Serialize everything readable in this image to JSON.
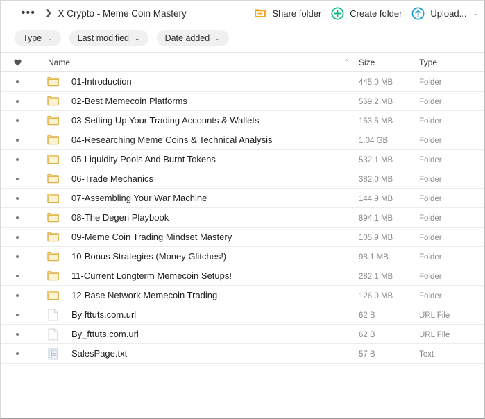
{
  "window": {
    "border_color": "#d8d8d8"
  },
  "breadcrumb": {
    "ellipsis": "•••",
    "separator": "❯",
    "title": "X Crypto - Meme Coin Mastery"
  },
  "toolbar": {
    "share_folder_label": "Share folder",
    "create_folder_label": "Create folder",
    "upload_label": "Upload...",
    "upload_caret": "⌄",
    "icons": {
      "share_folder": "share-folder-icon",
      "create_folder": "create-folder-icon",
      "upload": "upload-icon",
      "upload_caret": "chevron-down-icon"
    },
    "colors": {
      "share_folder": "#f5a623",
      "create_folder": "#00b87c",
      "upload": "#1e9ad6"
    }
  },
  "filters": [
    {
      "label": "Type",
      "caret": "⌄"
    },
    {
      "label": "Last modified",
      "caret": "⌄"
    },
    {
      "label": "Date added",
      "caret": "⌄"
    }
  ],
  "table": {
    "header": {
      "favorite_icon": "heart-icon",
      "name": "Name",
      "sort_caret": "⌃",
      "size": "Size",
      "type": "Type"
    },
    "rows": [
      {
        "icon": "folder-icon",
        "name": "01-Introduction",
        "size": "445.0 MB",
        "type": "Folder"
      },
      {
        "icon": "folder-icon",
        "name": "02-Best Memecoin Platforms",
        "size": "569.2 MB",
        "type": "Folder"
      },
      {
        "icon": "folder-icon",
        "name": "03-Setting Up Your Trading Accounts & Wallets",
        "size": "153.5 MB",
        "type": "Folder"
      },
      {
        "icon": "folder-icon",
        "name": "04-Researching Meme Coins & Technical Analysis",
        "size": "1.04 GB",
        "type": "Folder"
      },
      {
        "icon": "folder-icon",
        "name": "05-Liquidity Pools And Burnt Tokens",
        "size": "532.1 MB",
        "type": "Folder"
      },
      {
        "icon": "folder-icon",
        "name": "06-Trade Mechanics",
        "size": "382.0 MB",
        "type": "Folder"
      },
      {
        "icon": "folder-icon",
        "name": "07-Assembling Your War Machine",
        "size": "144.9 MB",
        "type": "Folder"
      },
      {
        "icon": "folder-icon",
        "name": "08-The Degen Playbook",
        "size": "894.1 MB",
        "type": "Folder"
      },
      {
        "icon": "folder-icon",
        "name": "09-Meme Coin Trading Mindset Mastery",
        "size": "105.9 MB",
        "type": "Folder"
      },
      {
        "icon": "folder-icon",
        "name": "10-Bonus Strategies (Money Glitches!)",
        "size": "98.1 MB",
        "type": "Folder"
      },
      {
        "icon": "folder-icon",
        "name": "11-Current Longterm Memecoin Setups!",
        "size": "282.1 MB",
        "type": "Folder"
      },
      {
        "icon": "folder-icon",
        "name": "12-Base Network Memecoin Trading",
        "size": "126.0 MB",
        "type": "Folder"
      },
      {
        "icon": "url-file-icon",
        "name": "By fttuts.com.url",
        "size": "62 B",
        "type": "URL File"
      },
      {
        "icon": "url-file-icon",
        "name": "By_fttuts.com.url",
        "size": "62 B",
        "type": "URL File"
      },
      {
        "icon": "text-file-icon",
        "name": "SalesPage.txt",
        "size": "57 B",
        "type": "Text"
      }
    ]
  }
}
